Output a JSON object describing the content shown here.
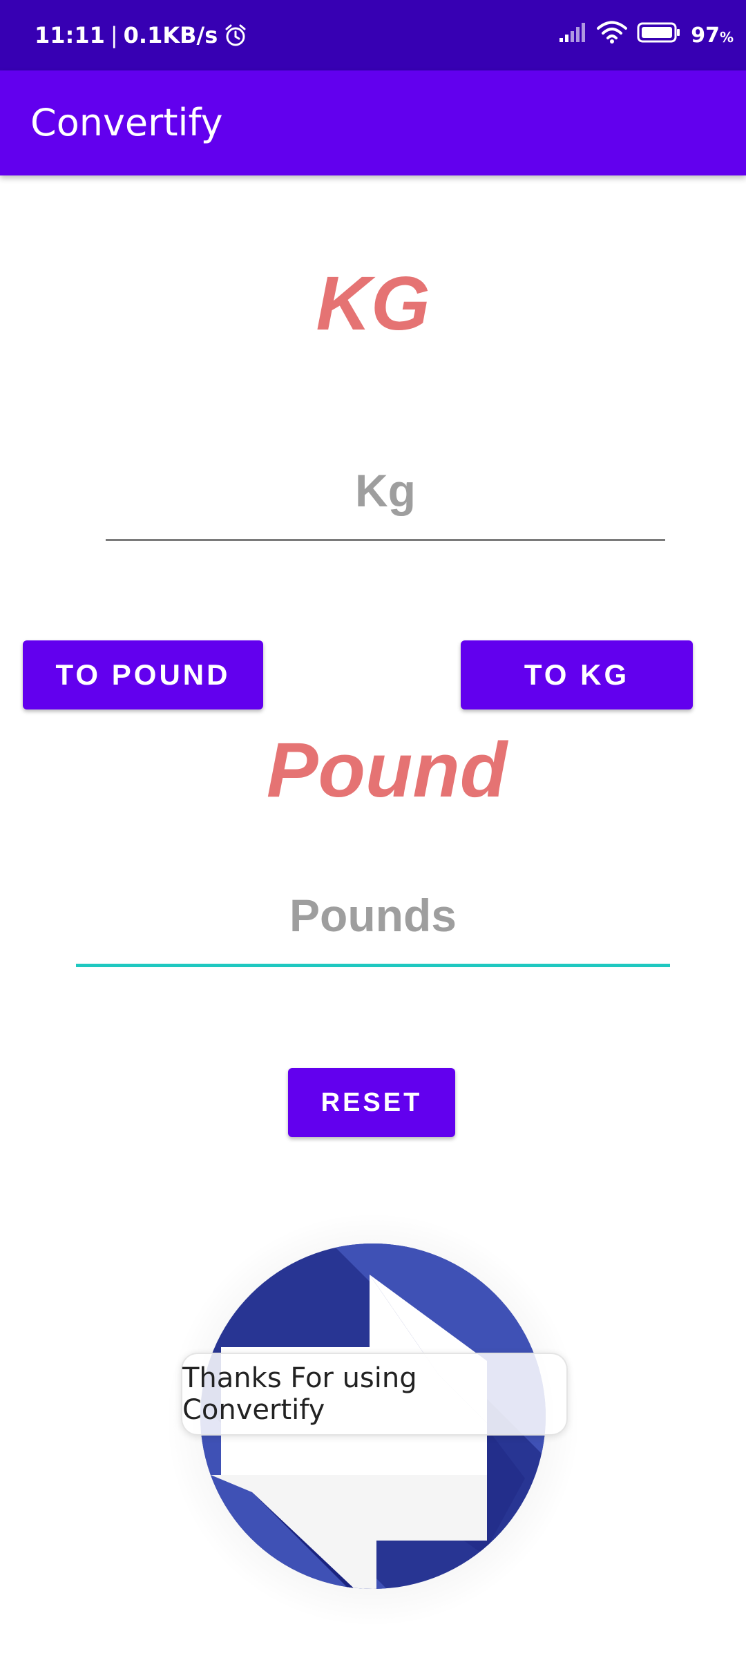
{
  "status_bar": {
    "time": "11:11",
    "separator": "|",
    "network_speed": "0.1KB/s",
    "battery_percent": "97",
    "battery_unit": "%",
    "icons": [
      "alarm-icon",
      "signal-icon",
      "wifi-icon",
      "battery-icon"
    ]
  },
  "app_bar": {
    "title": "Convertify",
    "color": "#6200EE"
  },
  "kg_section": {
    "heading": "KG",
    "input_placeholder": "Kg",
    "input_value": ""
  },
  "buttons": {
    "to_pound": "TO POUND",
    "to_kg": "TO KG",
    "reset": "RESET"
  },
  "pound_section": {
    "heading": "Pound",
    "input_placeholder": "Pounds",
    "input_value": ""
  },
  "logo": {
    "icon": "convert-arrows-logo-icon"
  },
  "toast": {
    "message": "Thanks For using Convertify"
  },
  "colors": {
    "status_bar": "#3700B3",
    "primary": "#6200EE",
    "heading": "#E57373",
    "accent": "#1FC8C0",
    "logo_dark": "#283593",
    "logo_light": "#3F51B5"
  }
}
